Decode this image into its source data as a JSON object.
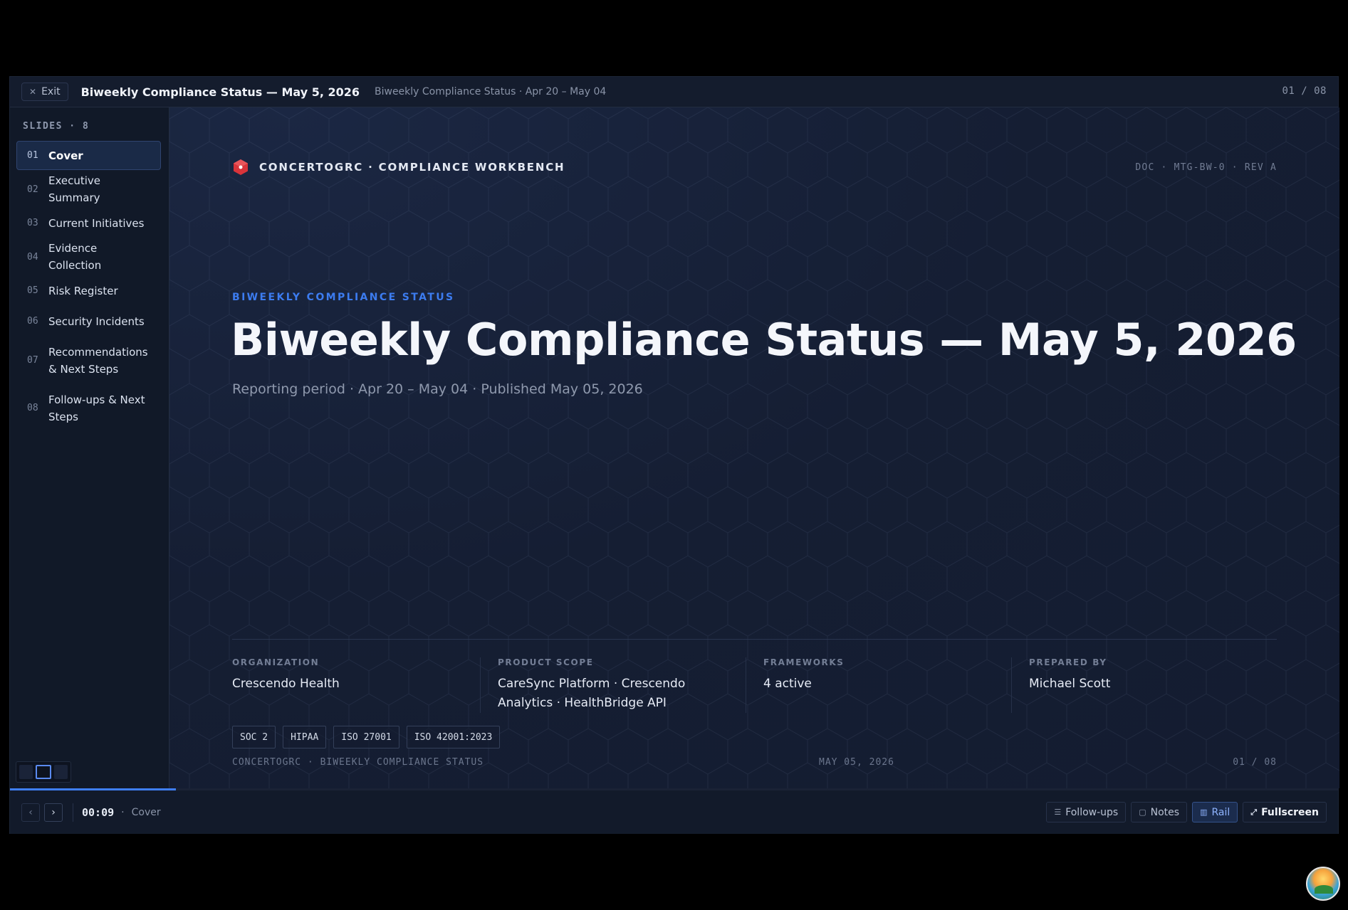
{
  "topbar": {
    "exit_label": "Exit",
    "title": "Biweekly Compliance Status — May 5, 2026",
    "subtitle": "Biweekly Compliance Status · Apr 20 – May 04",
    "counter": "01  /  08"
  },
  "sidebar": {
    "heading": "SLIDES · 8",
    "items": [
      {
        "num": "01",
        "label": "Cover"
      },
      {
        "num": "02",
        "label": "Executive Summary"
      },
      {
        "num": "03",
        "label": "Current Initiatives"
      },
      {
        "num": "04",
        "label": "Evidence Collection"
      },
      {
        "num": "05",
        "label": "Risk Register"
      },
      {
        "num": "06",
        "label": "Security Incidents"
      },
      {
        "num": "07",
        "label": "Recommendations & Next Steps"
      },
      {
        "num": "08",
        "label": "Follow-ups & Next Steps"
      }
    ],
    "active_index": 0
  },
  "slide": {
    "brand": "CONCERTOGRC · COMPLIANCE WORKBENCH",
    "doc_id": "DOC · MTG-BW-0 · REV A",
    "kicker": "BIWEEKLY COMPLIANCE STATUS",
    "title": "Biweekly Compliance Status — May 5, 2026",
    "subtitle": "Reporting period · Apr 20 – May 04 · Published May 05, 2026",
    "meta": [
      {
        "label": "ORGANIZATION",
        "value": "Crescendo Health"
      },
      {
        "label": "PRODUCT SCOPE",
        "value": "CareSync Platform · Crescendo Analytics · HealthBridge API"
      },
      {
        "label": "FRAMEWORKS",
        "value": "4 active"
      },
      {
        "label": "PREPARED BY",
        "value": "Michael Scott"
      }
    ],
    "tags": [
      "SOC 2",
      "HIPAA",
      "ISO 27001",
      "ISO 42001:2023"
    ],
    "footer": {
      "left": "CONCERTOGRC · BIWEEKLY COMPLIANCE STATUS",
      "middle": "MAY 05, 2026",
      "right": "01 / 08"
    }
  },
  "progress": {
    "fraction": 0.125
  },
  "bottombar": {
    "timer": "00:09",
    "current_slide": "Cover",
    "buttons": {
      "followups": "Follow-ups",
      "notes": "Notes",
      "rail": "Rail",
      "fullscreen": "Fullscreen"
    }
  },
  "colors": {
    "accent": "#3f7ef5",
    "brand_logo": "#d9343a",
    "background": "#141c30"
  }
}
